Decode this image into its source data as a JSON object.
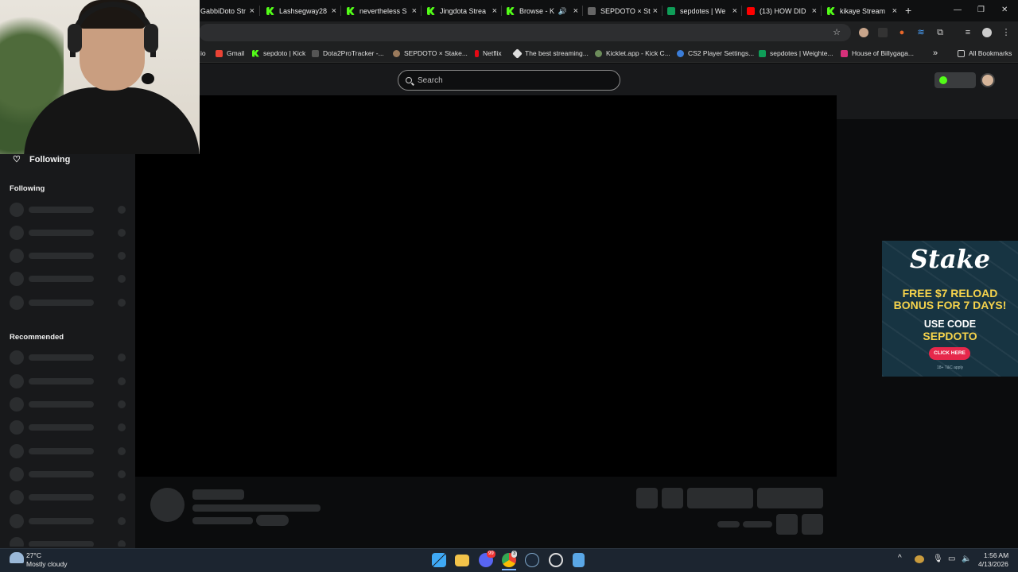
{
  "browser": {
    "tabs": [
      {
        "title": "GabbiDoto Str",
        "icon": "kick-icon"
      },
      {
        "title": "Lashsegway28",
        "icon": "kick-icon"
      },
      {
        "title": "nevertheless S",
        "icon": "kick-icon"
      },
      {
        "title": "Jingdota Strea",
        "icon": "kick-icon"
      },
      {
        "title": "Browse - K",
        "icon": "kick-icon"
      },
      {
        "title": "SEPDOTO × St",
        "icon": "stake-icon"
      },
      {
        "title": "sepdotes | We",
        "icon": "sheets-icon"
      },
      {
        "title": "(13) HOW DID",
        "icon": "youtube-icon"
      },
      {
        "title": "kikaye Stream",
        "icon": "kick-icon"
      }
    ],
    "new_tab": "+",
    "window_controls": {
      "minimize": "—",
      "restore": "❐",
      "close": "✕"
    },
    "bookmarks": [
      {
        "label": "io",
        "icon": "bookmark-icon"
      },
      {
        "label": "Gmail",
        "icon": "gmail-icon"
      },
      {
        "label": "sepdoto | Kick",
        "icon": "kick-icon"
      },
      {
        "label": "Dota2ProTracker -...",
        "icon": "dota-icon"
      },
      {
        "label": "SEPDOTO × Stake...",
        "icon": "stake-icon"
      },
      {
        "label": "Netflix",
        "icon": "netflix-icon"
      },
      {
        "label": "The best streaming...",
        "icon": "streaming-icon"
      },
      {
        "label": "Kicklet.app - Kick C...",
        "icon": "kicklet-icon"
      },
      {
        "label": "CS2 Player Settings...",
        "icon": "gear-icon"
      },
      {
        "label": "sepdotes | Weighte...",
        "icon": "sheets-icon"
      },
      {
        "label": "House of Billygaga...",
        "icon": "instagram-icon"
      }
    ],
    "all_bookmarks": "All Bookmarks",
    "more_bookmarks": "»"
  },
  "kick": {
    "search_placeholder": "Search",
    "sidebar": {
      "following_nav": "Following",
      "following_section": "Following",
      "recommended_section": "Recommended"
    }
  },
  "ad": {
    "brand": "Stake",
    "line1": "FREE $7 RELOAD",
    "line2": "BONUS FOR 7 DAYS!",
    "line3": "USE CODE",
    "code": "SEPDOTO",
    "cta": "CLICK HERE",
    "domain": "18+ T&C apply"
  },
  "taskbar": {
    "weather_temp": "27°C",
    "weather_desc": "Mostly cloudy",
    "time": "1:56 AM",
    "date": "4/13/2026",
    "badges": {
      "discord": "99",
      "chrome": "3"
    }
  },
  "colors": {
    "kick_green": "#53fc18",
    "background": "#0b0c0d",
    "skeleton": "#2b2d2f",
    "stake_yellow": "#f6d34c"
  }
}
